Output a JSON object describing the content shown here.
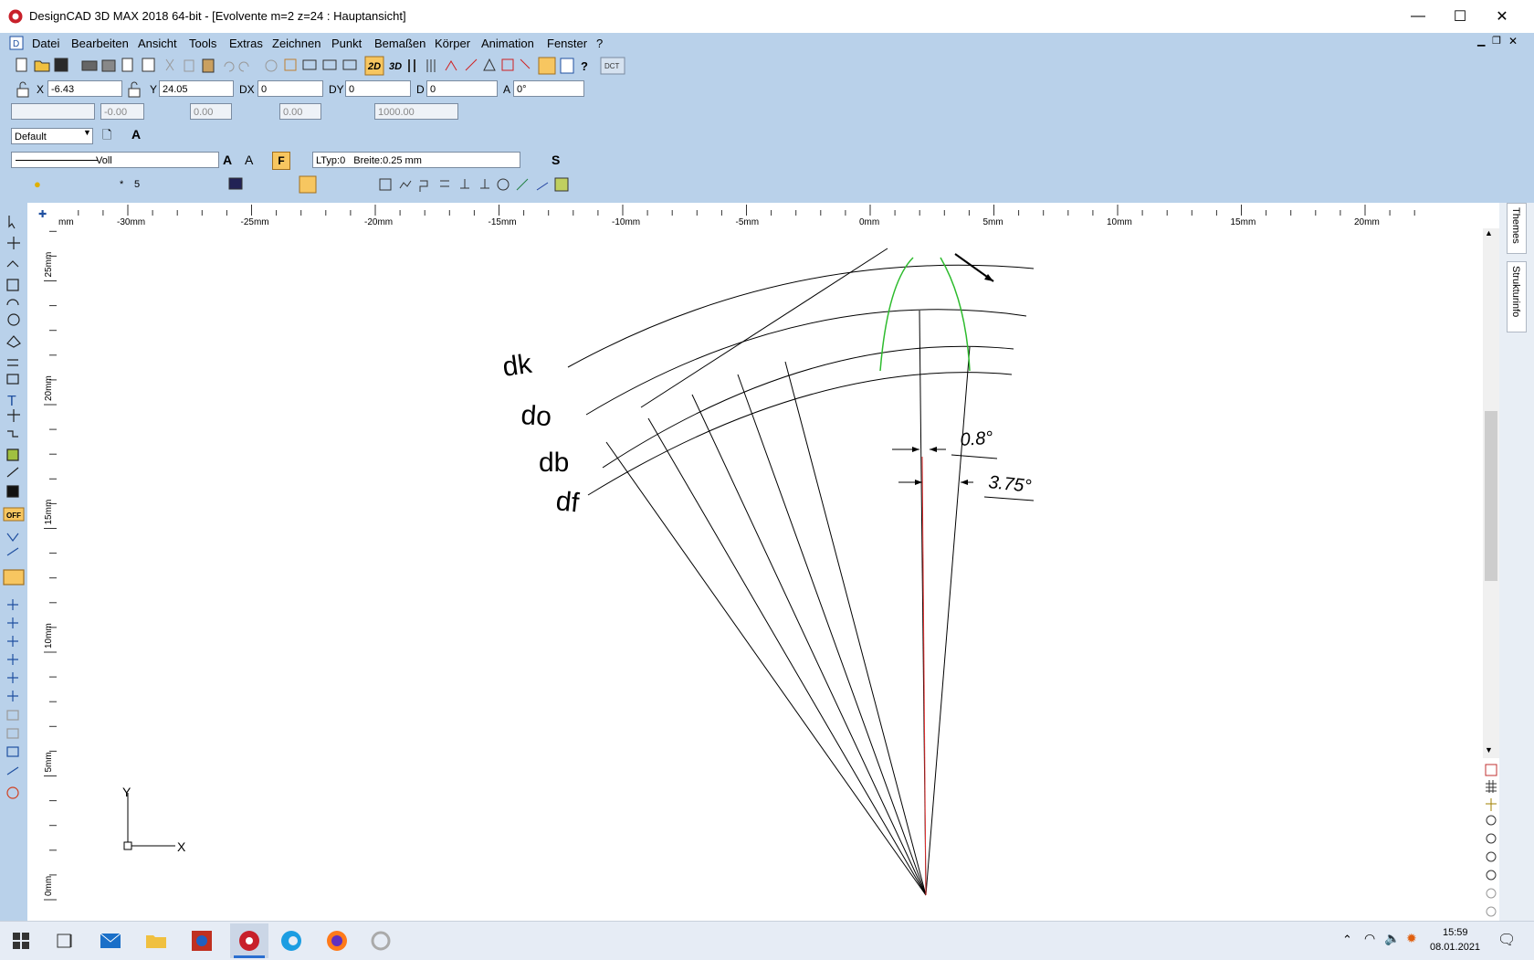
{
  "window": {
    "title": "DesignCAD 3D MAX 2018 64-bit - [Evolvente m=2  z=24 : Hauptansicht]",
    "controls": {
      "minimize": "—",
      "maximize": "☐",
      "close": "✕"
    }
  },
  "menu": [
    "Datei",
    "Bearbeiten",
    "Ansicht",
    "Tools",
    "Extras",
    "Zeichnen",
    "Punkt",
    "Bemaßen",
    "Körper",
    "Animation",
    "Fenster",
    "?"
  ],
  "toolbar": {
    "dct": "DCT",
    "btn2d": "2D",
    "btn3d": "3D"
  },
  "coords": {
    "x_label": "X",
    "x": "-6.43",
    "y_label": "Y",
    "y": "24.05",
    "dx_label": "DX",
    "dx": "0",
    "dy_label": "DY",
    "dy": "0",
    "d_label": "D",
    "d": "0",
    "a_label": "A",
    "a": "0°"
  },
  "row3": {
    "v1": "-0.00",
    "v2": "0.00",
    "v3": "0.00",
    "v4": "1000.00"
  },
  "style": {
    "preset": "Default"
  },
  "line": {
    "type": "Voll",
    "ltyp": "LTyp:0",
    "breite": "Breite:0.25 mm",
    "f_button": "F"
  },
  "layer": {
    "star": "*",
    "number": "5"
  },
  "ruler": {
    "h_ticks": [
      "mm",
      "-30mm",
      "-25mm",
      "-20mm",
      "-15mm",
      "-10mm",
      "-5mm",
      "0mm",
      "5mm",
      "10mm",
      "15mm",
      "20mm"
    ],
    "v_ticks": [
      "25mm",
      "20mm",
      "15mm",
      "10mm",
      "5mm",
      "0mm"
    ]
  },
  "drawing": {
    "labels": {
      "dk": "dk",
      "do": "do",
      "db": "db",
      "df": "df"
    },
    "dim1": "0.8°",
    "dim2": "3.75°",
    "axis_x": "X",
    "axis_y": "Y",
    "colors": {
      "tooth": "#2dbb2d",
      "centerline": "#e03030"
    }
  },
  "right_tabs": [
    "Themes",
    "Strukturinfo"
  ],
  "tray": {
    "time": "15:59",
    "date": "08.01.2021"
  }
}
